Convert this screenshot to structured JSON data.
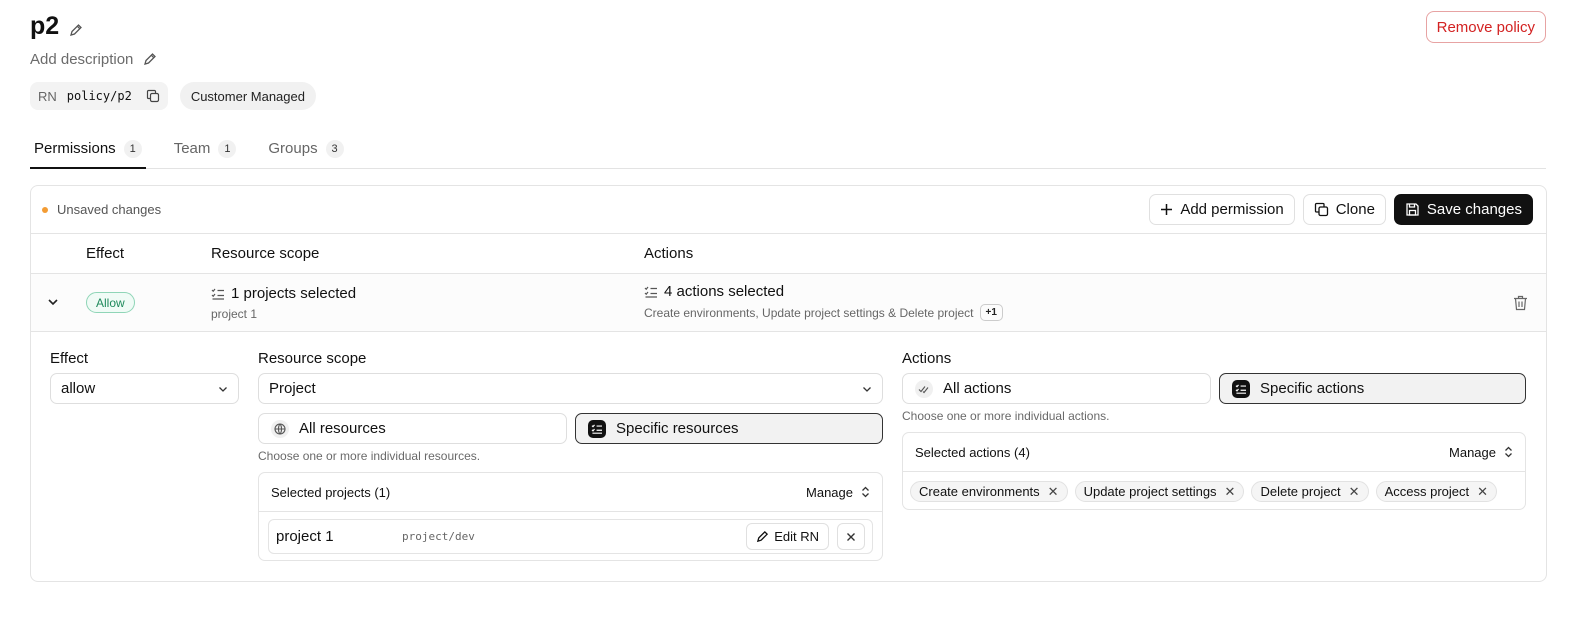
{
  "header": {
    "title": "p2",
    "description_placeholder": "Add description",
    "remove_label": "Remove policy",
    "rn_label": "RN",
    "rn_value": "policy/p2",
    "managed_badge": "Customer Managed"
  },
  "tabs": [
    {
      "label": "Permissions",
      "count": "1",
      "active": true
    },
    {
      "label": "Team",
      "count": "1"
    },
    {
      "label": "Groups",
      "count": "3"
    }
  ],
  "toolbar": {
    "status": "Unsaved changes",
    "add_permission": "Add permission",
    "clone": "Clone",
    "save": "Save changes",
    "status_color": "#f39c34"
  },
  "columns": {
    "effect": "Effect",
    "scope": "Resource scope",
    "actions": "Actions"
  },
  "permission": {
    "effect_badge": "Allow",
    "scope_title": "1 projects selected",
    "scope_sub": "project 1",
    "actions_title": "4 actions selected",
    "actions_sub": "Create environments, Update project settings & Delete project",
    "actions_more": "+1"
  },
  "editor": {
    "effect_label": "Effect",
    "effect_value": "allow",
    "scope_label": "Resource scope",
    "scope_value": "Project",
    "all_resources": "All resources",
    "specific_resources": "Specific resources",
    "resources_hint": "Choose one or more individual resources.",
    "selected_projects": "Selected projects (1)",
    "manage": "Manage",
    "project_name": "project 1",
    "project_rn": "project/dev",
    "edit_rn": "Edit RN",
    "actions_label": "Actions",
    "all_actions": "All actions",
    "specific_actions": "Specific actions",
    "actions_hint": "Choose one or more individual actions.",
    "selected_actions": "Selected actions (4)",
    "action_tags": [
      "Create environments",
      "Update project settings",
      "Delete project",
      "Access project"
    ]
  }
}
